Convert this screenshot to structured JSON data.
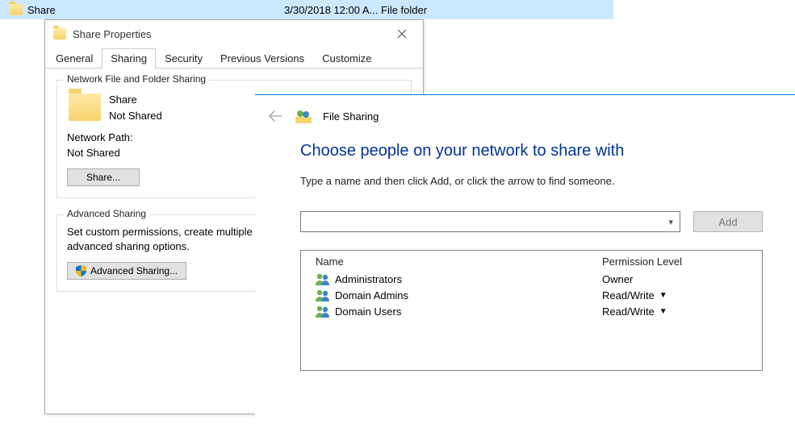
{
  "explorer": {
    "name": "Share",
    "date": "3/30/2018 12:00 A...",
    "type": "File folder"
  },
  "properties": {
    "title": "Share Properties",
    "tabs": {
      "general": "General",
      "sharing": "Sharing",
      "security": "Security",
      "previous": "Previous Versions",
      "customize": "Customize"
    },
    "network_group": {
      "title": "Network File and Folder Sharing",
      "item_name": "Share",
      "item_status": "Not Shared",
      "path_label": "Network Path:",
      "path_value": "Not Shared",
      "share_btn": "Share..."
    },
    "advanced_group": {
      "title": "Advanced Sharing",
      "desc": "Set custom permissions, create multiple shares, and set other advanced sharing options.",
      "btn": "Advanced Sharing..."
    }
  },
  "wizard": {
    "header_icon_label": "File Sharing",
    "heading": "Choose people on your network to share with",
    "sub": "Type a name and then click Add, or click the arrow to find someone.",
    "add_btn": "Add",
    "columns": {
      "name": "Name",
      "perm": "Permission Level"
    },
    "rows": [
      {
        "name": "Administrators",
        "perm": "Owner",
        "editable": false
      },
      {
        "name": "Domain Admins",
        "perm": "Read/Write",
        "editable": true
      },
      {
        "name": "Domain Users",
        "perm": "Read/Write",
        "editable": true
      }
    ]
  }
}
